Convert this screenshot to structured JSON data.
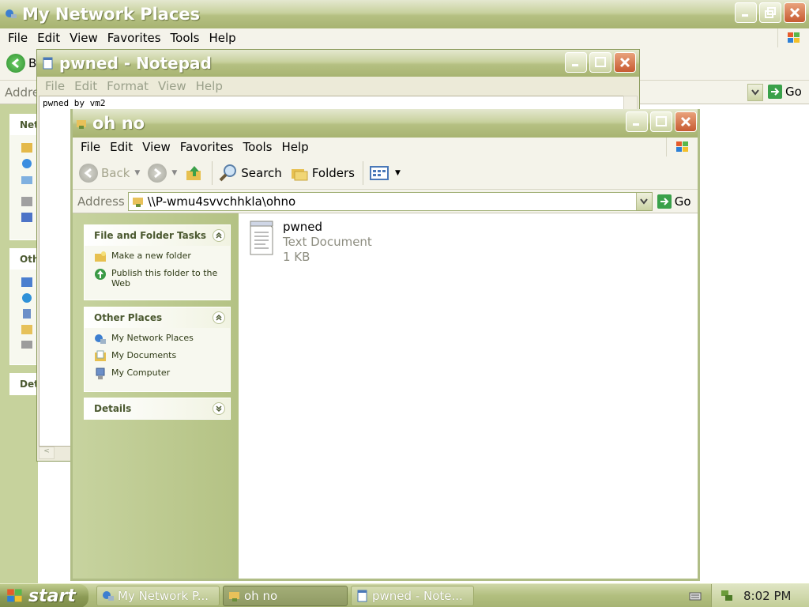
{
  "network_window": {
    "title": "My Network Places",
    "menu": [
      "File",
      "Edit",
      "View",
      "Favorites",
      "Tools",
      "Help"
    ],
    "back_label": "B",
    "address_label": "Addre",
    "go_label": "Go",
    "pane_headers": [
      "Net",
      "Oth",
      "Det"
    ]
  },
  "notepad": {
    "title": "pwned - Notepad",
    "menu": [
      "File",
      "Edit",
      "Format",
      "View",
      "Help"
    ],
    "content": "pwned by vm2"
  },
  "explorer": {
    "title": "oh no",
    "menu": [
      "File",
      "Edit",
      "View",
      "Favorites",
      "Tools",
      "Help"
    ],
    "toolbar": {
      "back": "Back",
      "search": "Search",
      "folders": "Folders"
    },
    "address_label": "Address",
    "address_value": "\\\\P-wmu4svvchhkla\\ohno",
    "go_label": "Go",
    "file_tasks": {
      "title": "File and Folder Tasks",
      "items": [
        "Make a new folder",
        "Publish this folder to the Web"
      ]
    },
    "other_places": {
      "title": "Other Places",
      "items": [
        "My Network Places",
        "My Documents",
        "My Computer"
      ]
    },
    "details": {
      "title": "Details"
    },
    "file": {
      "name": "pwned",
      "type": "Text Document",
      "size": "1 KB"
    }
  },
  "taskbar": {
    "start": "start",
    "buttons": [
      "My Network P...",
      "oh no",
      "pwned - Note..."
    ],
    "active_index": 1,
    "clock": "8:02 PM"
  },
  "colors": {
    "title_gradient_top": "#e4e8cf",
    "title_gradient_bottom": "#a7b371",
    "pane_green": "#c7d39f",
    "task_link": "#2e3a15",
    "close_red": "#c75a32"
  }
}
